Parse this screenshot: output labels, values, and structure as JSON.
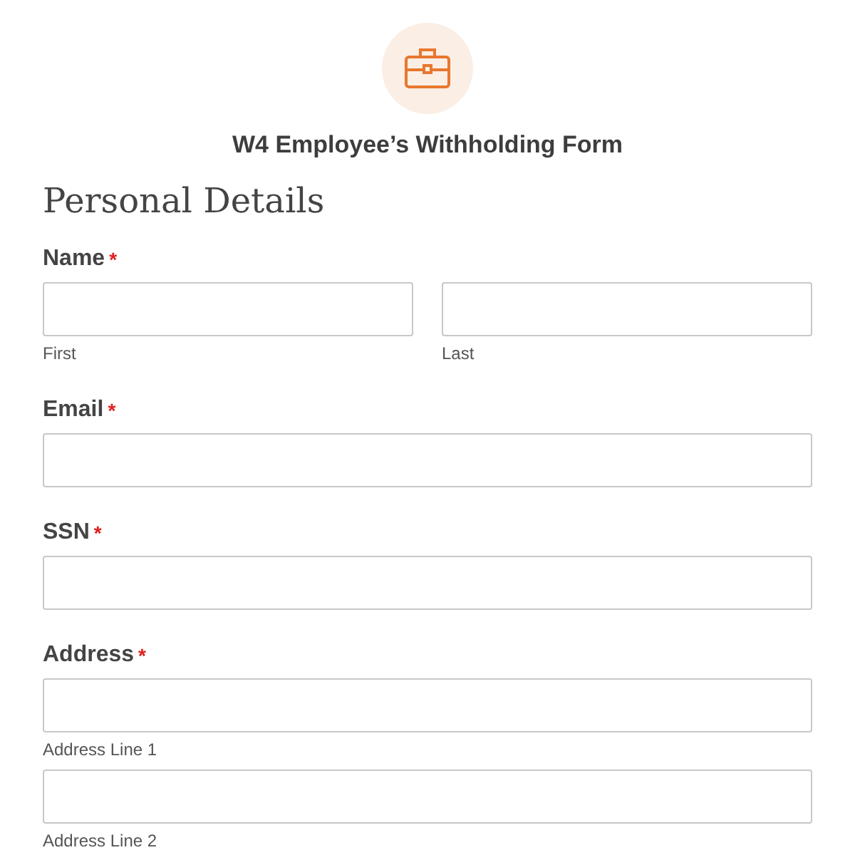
{
  "form": {
    "title": "W4 Employee’s Withholding Form"
  },
  "section": {
    "heading": "Personal Details"
  },
  "fields": [
    {
      "label": "Name",
      "required_mark": "*",
      "rows": [
        [
          {
            "sublabel": "First"
          },
          {
            "sublabel": "Last"
          }
        ]
      ]
    },
    {
      "label": "Email",
      "required_mark": "*",
      "rows": [
        [
          {}
        ]
      ]
    },
    {
      "label": "SSN",
      "required_mark": "*",
      "rows": [
        [
          {}
        ]
      ]
    },
    {
      "label": "Address",
      "required_mark": "*",
      "rows": [
        [
          {
            "sublabel": "Address Line 1"
          }
        ],
        [
          {
            "sublabel": "Address Line 2"
          }
        ]
      ]
    }
  ]
}
